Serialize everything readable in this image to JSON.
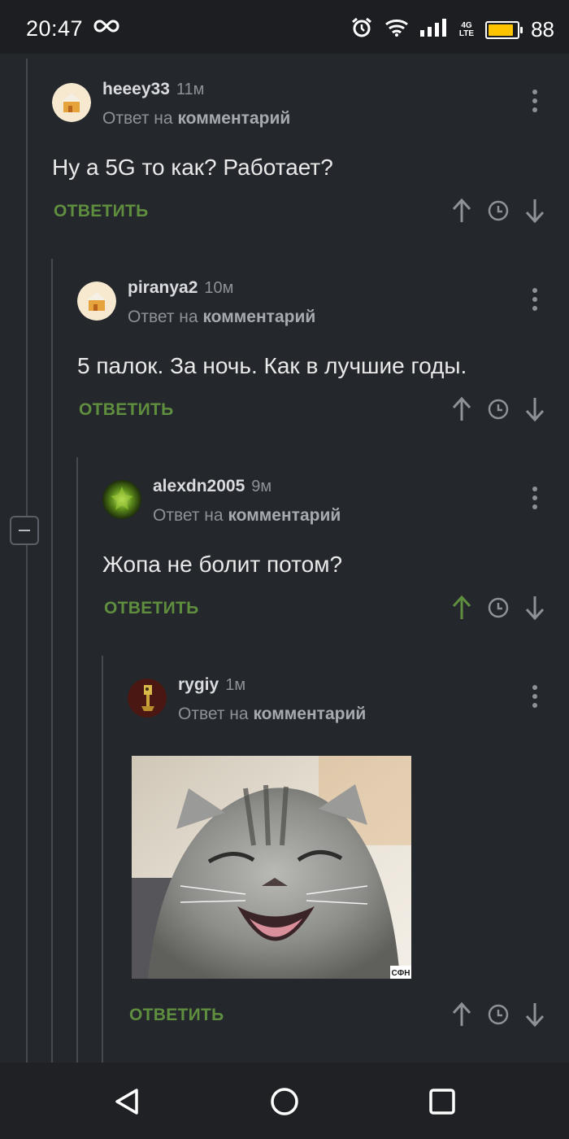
{
  "status_bar": {
    "time": "20:47",
    "network": "4G",
    "network_sub": "LTE",
    "battery": "88",
    "battery_level": 0.88,
    "icons": [
      "infinity-icon",
      "alarm-icon",
      "wifi-icon",
      "signal-icon",
      "battery-icon"
    ]
  },
  "comments": [
    {
      "user": "heeey33",
      "time": "11м",
      "reply_prefix": "Ответ на",
      "reply_link": "комментарий",
      "text": "Ну а 5G то как? Работает?",
      "reply_label": "ОТВЕТИТЬ"
    },
    {
      "user": "piranya2",
      "time": "10м",
      "reply_prefix": "Ответ на",
      "reply_link": "комментарий",
      "text": "5 палок. За ночь. Как в лучшие годы.",
      "reply_label": "ОТВЕТИТЬ"
    },
    {
      "user": "alexdn2005",
      "time": "9м",
      "reply_prefix": "Ответ на",
      "reply_link": "комментарий",
      "text": "Жопа не болит потом?",
      "reply_label": "ОТВЕТИТЬ",
      "upvoted": true
    },
    {
      "user": "rygiy",
      "time": "1м",
      "reply_prefix": "Ответ на",
      "reply_link": "комментарий",
      "image_watermark": "СФН",
      "reply_label": "ОТВЕТИТЬ"
    }
  ],
  "colors": {
    "background": "#24272c",
    "accent_green": "#5f8f3e",
    "muted": "#8d9299"
  },
  "nav_bar": {
    "icons": [
      "back-icon",
      "home-icon",
      "recents-icon"
    ]
  }
}
